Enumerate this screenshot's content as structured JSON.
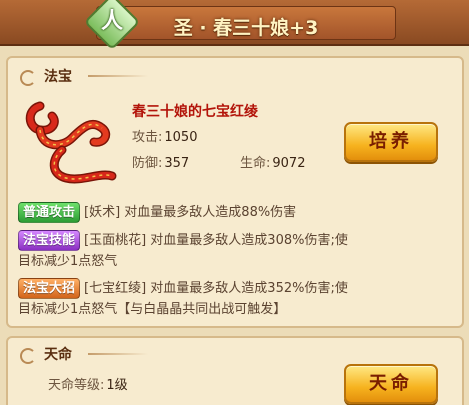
{
  "header": {
    "badge_char": "人",
    "title": "圣 · 春三十娘+3"
  },
  "treasure_section": {
    "title": "法宝",
    "item_name": "春三十娘的七宝红绫",
    "attack_label": "攻击:",
    "attack_value": "1050",
    "defense_label": "防御:",
    "defense_value": "357",
    "life_label": "生命:",
    "life_value": "9072",
    "train_button": "培养",
    "icon": "red-silk-ribbon-icon"
  },
  "skills": [
    {
      "tag": "普通攻击",
      "color": "#3aa83c",
      "line1": "[妖术] 对血量最多敌人造成88%伤害",
      "line2": ""
    },
    {
      "tag": "法宝技能",
      "color": "#9b3ad0",
      "line1": "[玉面桃花] 对血量最多敌人造成308%伤害;使",
      "line2": "目标减少1点怒气"
    },
    {
      "tag": "法宝大招",
      "color": "#dc7224",
      "line1": "[七宝红绫] 对血量最多敌人造成352%伤害;使",
      "line2": "目标减少1点怒气【与白晶晶共同出战可触发】"
    }
  ],
  "fate_section": {
    "title": "天命",
    "level_label": "天命等级:",
    "level_value": "1级",
    "button": "天命"
  }
}
